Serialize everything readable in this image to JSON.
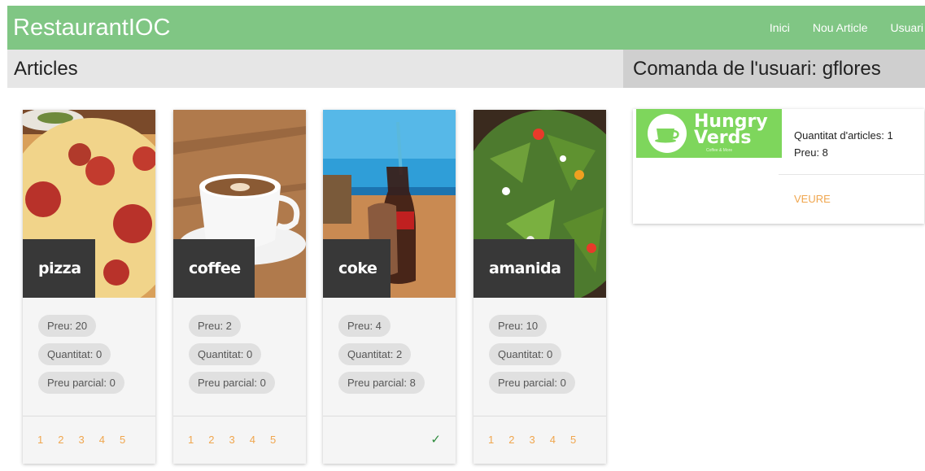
{
  "app": {
    "title": "RestaurantIOC"
  },
  "nav": {
    "items": [
      "Inici",
      "Nou Article",
      "Usuari"
    ]
  },
  "articles": {
    "heading": "Articles",
    "items": [
      {
        "name": "pizza",
        "price": "Preu: 20",
        "quantity": "Quantitat: 0",
        "partial": "Preu parcial: 0",
        "ratings": [
          "1",
          "2",
          "3",
          "4",
          "5"
        ],
        "selected": false
      },
      {
        "name": "coffee",
        "price": "Preu: 2",
        "quantity": "Quantitat: 0",
        "partial": "Preu parcial: 0",
        "ratings": [
          "1",
          "2",
          "3",
          "4",
          "5"
        ],
        "selected": false
      },
      {
        "name": "coke",
        "price": "Preu: 4",
        "quantity": "Quantitat: 2",
        "partial": "Preu parcial: 8",
        "ratings": [],
        "selected": true,
        "check": "✓"
      },
      {
        "name": "amanida",
        "price": "Preu: 10",
        "quantity": "Quantitat: 0",
        "partial": "Preu parcial: 0",
        "ratings": [
          "1",
          "2",
          "3",
          "4",
          "5"
        ],
        "selected": false
      }
    ]
  },
  "order": {
    "heading": "Comanda de l'usuari: gflores",
    "logo": {
      "line1": "Hungry",
      "line2": "Verds",
      "sub": "Coffee & More"
    },
    "count": "Quantitat d'articles: 1",
    "price": "Preu: 8",
    "link": "VEURE"
  },
  "colors": {
    "nav": "#80c684",
    "accent": "#f0a64e",
    "check": "#2e8b3d",
    "logo": "#7ed65c"
  }
}
